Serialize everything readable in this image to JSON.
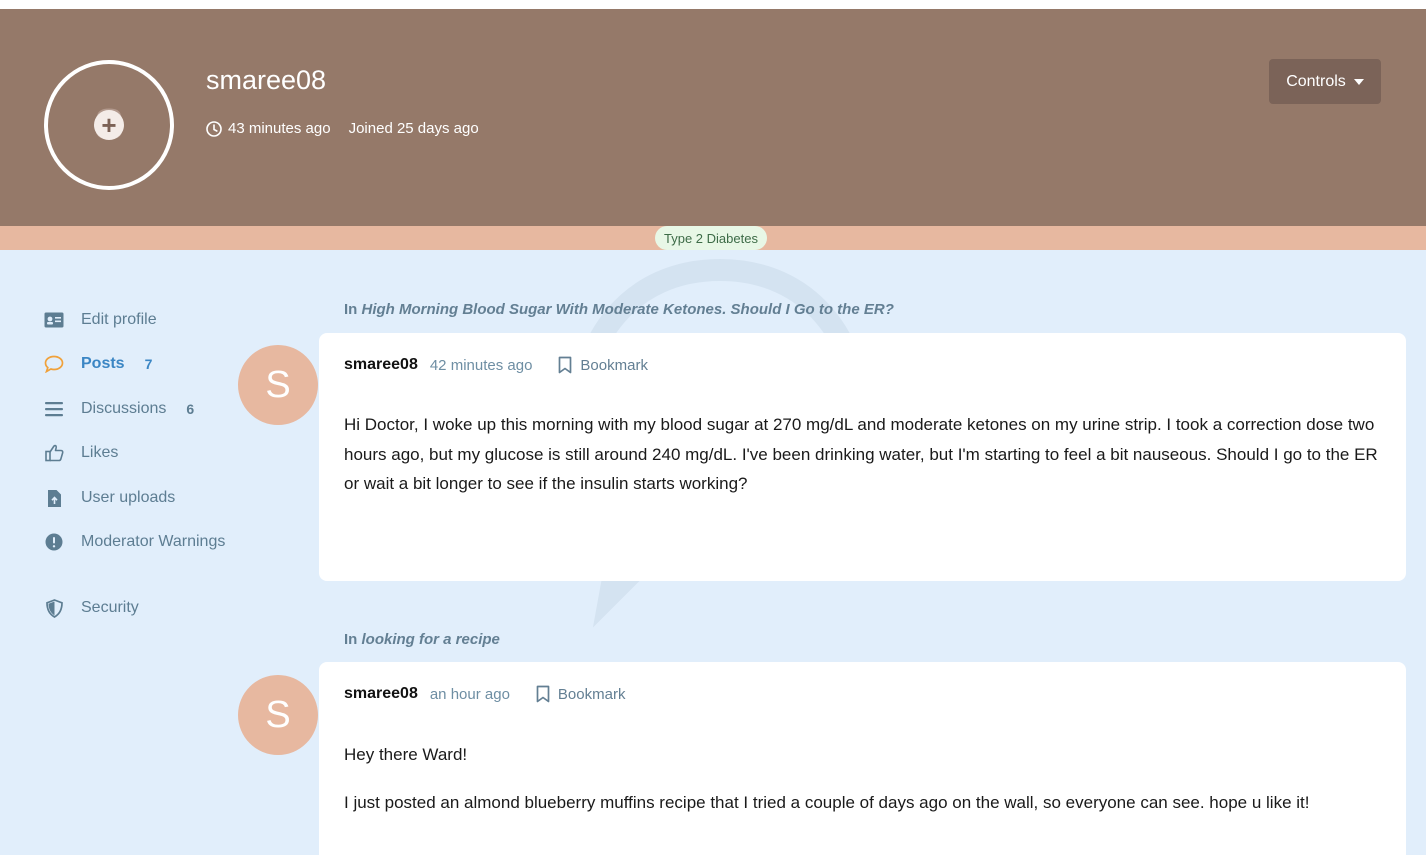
{
  "profile": {
    "username": "smaree08",
    "avatar_letter": "S",
    "last_seen": "43 minutes ago",
    "joined": "Joined 25 days ago",
    "controls_label": "Controls",
    "group_badge": "Type 2 Diabetes"
  },
  "colors": {
    "hero_bg": "#957969",
    "tag_bar": "#e7b8a0",
    "page_bg": "#e1eefb",
    "active_link": "#3b86c4",
    "icon_orange": "#f0a13a"
  },
  "sidebar": {
    "items": [
      {
        "label": "Edit profile",
        "icon": "id-card-icon",
        "count": ""
      },
      {
        "label": "Posts",
        "icon": "comment-icon",
        "count": "7"
      },
      {
        "label": "Discussions",
        "icon": "bars-icon",
        "count": "6"
      },
      {
        "label": "Likes",
        "icon": "thumbs-up-icon",
        "count": ""
      },
      {
        "label": "User uploads",
        "icon": "file-upload-icon",
        "count": ""
      },
      {
        "label": "Moderator Warnings",
        "icon": "exclamation-circle-icon",
        "count": ""
      },
      {
        "label": "Security",
        "icon": "shield-icon",
        "count": ""
      }
    ]
  },
  "posts": [
    {
      "context_prefix": "In",
      "discussion_title": "High Morning Blood Sugar With Moderate Ketones. Should I Go to the ER?",
      "author": "smaree08",
      "author_letter": "S",
      "time": "42 minutes ago",
      "bookmark_label": "Bookmark",
      "paragraphs": [
        "Hi Doctor, I woke up this morning with my blood sugar at 270 mg/dL and moderate ketones on my urine strip. I took a correction dose two hours ago, but my glucose is still around 240 mg/dL. I've been drinking water, but I'm starting to feel a bit nauseous. Should I go to the ER or wait a bit longer to see if the insulin starts working?"
      ]
    },
    {
      "context_prefix": "In",
      "discussion_title": "looking for a recipe",
      "author": "smaree08",
      "author_letter": "S",
      "time": "an hour ago",
      "bookmark_label": "Bookmark",
      "paragraphs": [
        "Hey there Ward!",
        "I just posted an almond blueberry muffins recipe that I tried a couple of days ago on the wall, so everyone can see. hope u like it!"
      ]
    }
  ]
}
